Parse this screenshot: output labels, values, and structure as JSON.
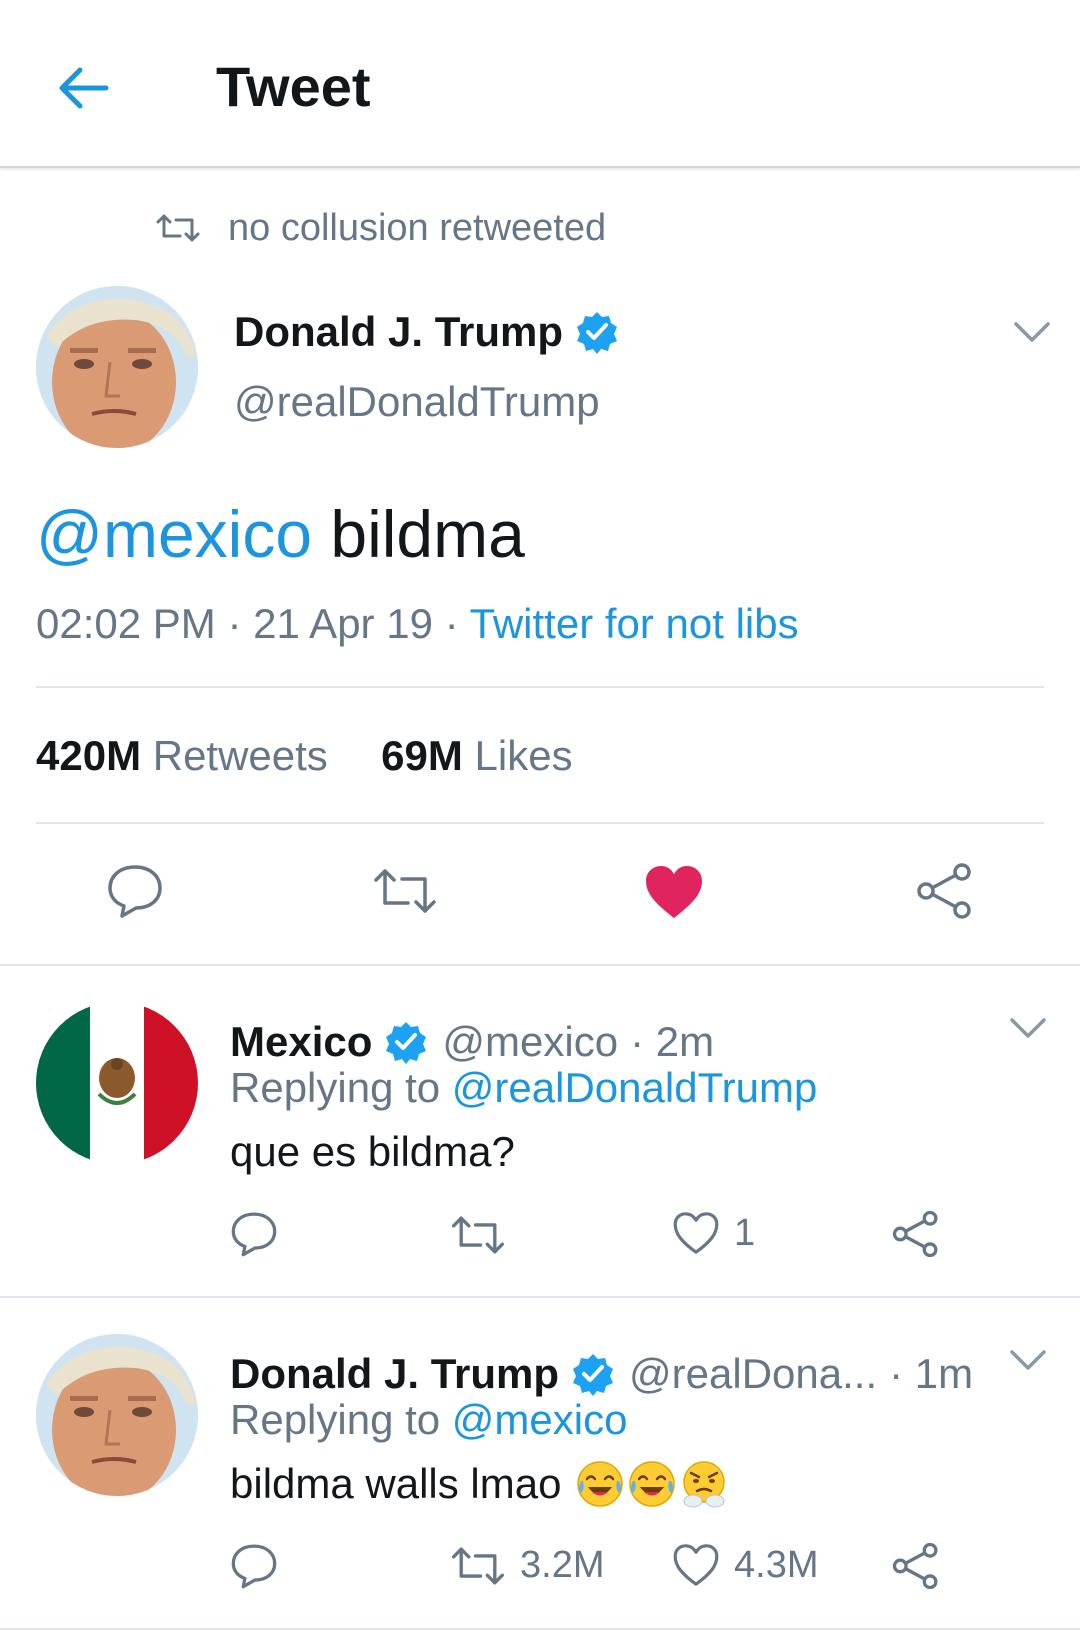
{
  "header": {
    "title": "Tweet",
    "back_icon": "arrow-left-icon"
  },
  "retweet_notice": {
    "text": "no collusion retweeted",
    "icon": "retweet-icon"
  },
  "main_tweet": {
    "author_name": "Donald J. Trump",
    "author_handle": "@realDonaldTrump",
    "verified": true,
    "mention": "@mexico",
    "text": " bildma",
    "time": "02:02 PM",
    "date": "21 Apr 19",
    "separator": " · ",
    "source": "Twitter for not libs",
    "retweets_count": "420M",
    "retweets_label": "Retweets",
    "likes_count": "69M",
    "likes_label": "Likes",
    "liked": true
  },
  "replies": [
    {
      "author_name": "Mexico",
      "author_handle": "@mexico",
      "time": "· 2m",
      "verified": true,
      "replying_label": "Replying to ",
      "replying_to": "@realDonaldTrump",
      "text": "que es bildma?",
      "retweet_count": "",
      "like_count": "1"
    },
    {
      "author_name": "Donald J. Trump",
      "author_handle": "@realDona...",
      "time": "· 1m",
      "verified": true,
      "replying_label": "Replying to ",
      "replying_to": "@mexico",
      "text": "bildma walls lmao",
      "emojis": [
        "face-with-tears-of-joy",
        "face-with-tears-of-joy",
        "face-with-steam-from-nose"
      ],
      "retweet_count": "3.2M",
      "like_count": "4.3M"
    }
  ],
  "colors": {
    "accent": "#1b95e0",
    "like_active": "#e0245e",
    "text_primary": "#14171a",
    "text_secondary": "#657786",
    "divider": "#e1e8ed"
  }
}
